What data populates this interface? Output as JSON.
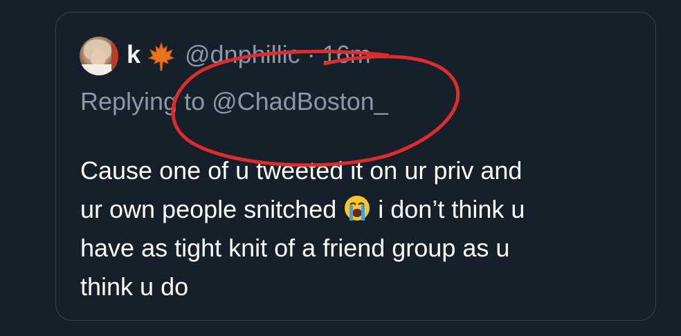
{
  "tweet": {
    "display_name": "k",
    "name_emoji": "maple-leaf-icon",
    "handle_time": "@dnphillic · 16m",
    "replying_prefix": "Replying to ",
    "replying_mention": "@ChadBoston_",
    "body_lines": [
      "Cause one of u tweeted it on ur priv and",
      "ur own people snitched",
      " i don’t think u",
      "have as tight knit of a friend group as u",
      "think u do"
    ],
    "body_emoji": "loudly-crying-face-icon"
  },
  "colors": {
    "background": "#15202b",
    "card_border": "#38444d",
    "text_primary": "#ffffff",
    "text_secondary": "#8b98a5",
    "annotation": "#e02b2b"
  }
}
